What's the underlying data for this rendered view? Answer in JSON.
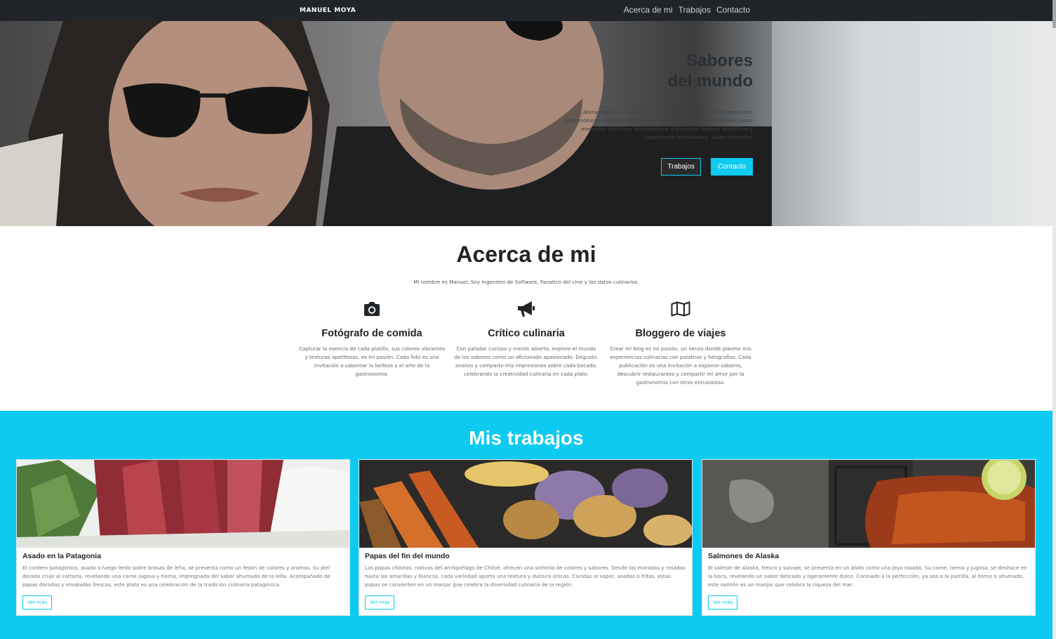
{
  "nav": {
    "brand": "MANUEL MOYA",
    "links": [
      "Acerca de mi",
      "Trabajos",
      "Contacto"
    ]
  },
  "hero": {
    "title_line1": "Sabores",
    "title_line2": "del mundo",
    "text": "¡Bienvenidos a mi pasión culinaria! Aquí encontrarás mis aventuras gastronómicas alrededor del mundo, desde restaurantes escondidos hasta mercados vibrantes. Acompáñame a descubrir sabores auténticos y experiencias inolvidables. ¡Buen provecho!",
    "btn_works": "Trabajos",
    "btn_contact": "Contacto"
  },
  "about": {
    "title": "Acerca de mi",
    "subtitle": "Mi nombre es Manuel, Soy Ingeniero de Software, Fanatico del cine y los datos culinarios.",
    "features": [
      {
        "icon": "camera-icon",
        "title": "Fotógrafo de comida",
        "text": "Capturar la esencia de cada platillo, sus colores vibrantes y texturas apetitosas, es mi pasión. Cada foto es una invitación a saborear la belleza y el arte de la gastronomía."
      },
      {
        "icon": "megaphone-icon",
        "title": "Crítico culinaria",
        "text": "Con paladar curioso y mente abierta, exploro el mundo de los sabores como un aficionado apasionado. Degusto, analizo y comparto mis impresiones sobre cada bocado, celebrando la creatividad culinaria en cada plato."
      },
      {
        "icon": "map-icon",
        "title": "Bloggero de viajes",
        "text": "Crear mi blog es mi pasión, un lienzo donde plasmo mis experiencias culinarias con palabras y fotografías. Cada publicación es una invitación a explorar sabores, descubrir restaurantes y compartir mi amor por la gastronomía con otros entusiastas."
      }
    ]
  },
  "works": {
    "title": "Mis trabajos",
    "cards": [
      {
        "title": "Asado en la Patagonia",
        "text": "El cordero patagónico, asado a fuego lento sobre brasas de leña, se presenta como un festín de colores y aromas. Su piel dorada cruje al cortarla, revelando una carne jugosa y tierna, impregnada del sabor ahumado de la leña. Acompañado de papas doradas y ensaladas frescas, este plato es una celebración de la tradición culinaria patagónica.",
        "button": "Ver más"
      },
      {
        "title": "Papas del fin del mundo",
        "text": "Las papas chilotas, nativas del archipiélago de Chiloé, ofrecen una sinfonía de colores y sabores. Desde las moradas y rosadas hasta las amarillas y blancas, cada variedad aporta una textura y dulzura únicas. Cocidas al vapor, asadas o fritas, estas papas se convierten en un manjar que celebra la diversidad culinaria de la región.",
        "button": "Ver más"
      },
      {
        "title": "Salmones de Alaska",
        "text": "El salmón de Alaska, fresco y salvaje, se presenta en un plato como una joya rosada. Su carne, tierna y jugosa, se deshace en la boca, revelando un sabor delicado y ligeramente dulce. Cocinado a la perfección, ya sea a la parrilla, al horno o ahumado, este salmón es un manjar que celebra la riqueza del mar.",
        "button": "Ver más"
      }
    ]
  },
  "colors": {
    "navbar": "#212529",
    "accent": "#0dcaf0",
    "text_dark": "#212529"
  }
}
